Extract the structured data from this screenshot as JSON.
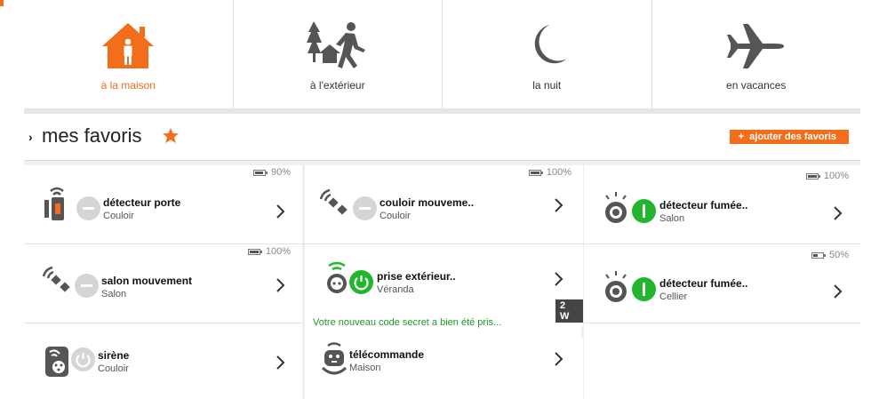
{
  "modes": [
    {
      "label": "à la maison",
      "icon": "house-person-icon",
      "active": true
    },
    {
      "label": "à l'extérieur",
      "icon": "walking-person-icon",
      "active": false
    },
    {
      "label": "la nuit",
      "icon": "moon-icon",
      "active": false
    },
    {
      "label": "en vacances",
      "icon": "airplane-icon",
      "active": false
    }
  ],
  "favorites": {
    "title": "mes favoris",
    "add_label": "+  ajouter des favoris"
  },
  "devices": [
    {
      "name": "détecteur porte",
      "location": "Couloir",
      "battery": "90%",
      "icon": "door-sensor-icon",
      "state": "off"
    },
    {
      "name": "couloir mouveme..",
      "location": "Couloir",
      "battery": "100%",
      "icon": "motion-sensor-icon",
      "state": "off"
    },
    {
      "name": "détecteur fumée..",
      "location": "Salon",
      "battery": "100%",
      "icon": "smoke-detector-icon",
      "state": "on"
    },
    {
      "name": "salon mouvement",
      "location": "Salon",
      "battery": "100%",
      "icon": "motion-sensor-icon",
      "state": "off"
    },
    {
      "name": "prise extérieur..",
      "location": "Véranda",
      "power": "2 W",
      "icon": "smart-plug-icon",
      "state": "on"
    },
    {
      "name": "détecteur fumée..",
      "location": "Cellier",
      "battery": "50%",
      "icon": "smoke-detector-icon",
      "state": "on"
    },
    {
      "name": "sirène",
      "location": "Couloir",
      "icon": "siren-icon",
      "state": "off"
    },
    {
      "name": "télécommande",
      "location": "Maison",
      "icon": "remote-control-icon",
      "state": "none"
    }
  ],
  "notice": "Votre nouveau code secret a bien été pris...",
  "colors": {
    "accent": "#f26e1b",
    "on": "#22b62e",
    "off": "#d5d5d5"
  }
}
